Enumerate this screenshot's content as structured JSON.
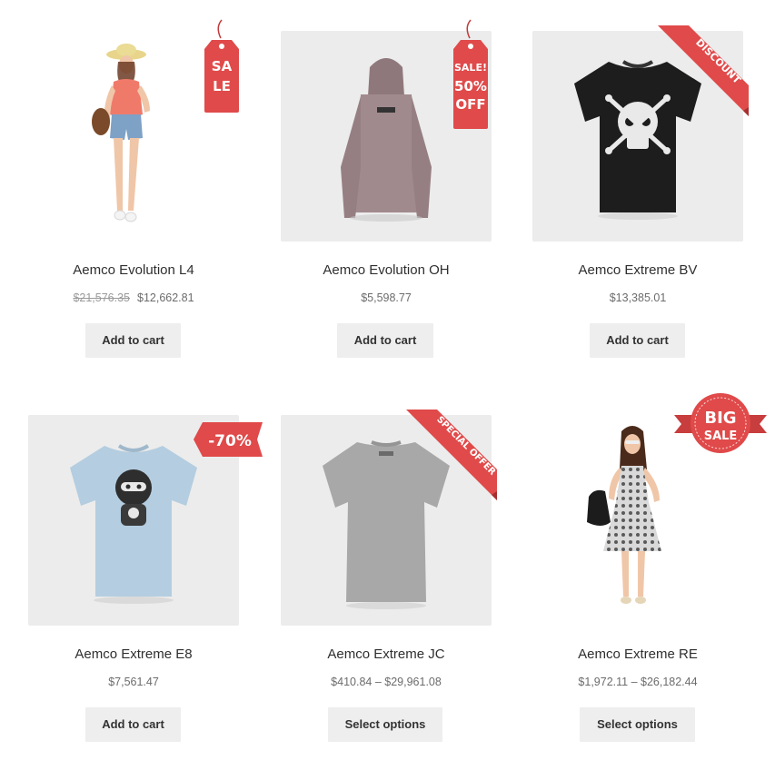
{
  "products": [
    {
      "name": "Aemco Evolution L4",
      "price_old": "$21,576.35",
      "price": "$12,662.81",
      "button": "Add to cart",
      "badge": {
        "lines": [
          "SA",
          "LE"
        ],
        "style": "hang-tag"
      }
    },
    {
      "name": "Aemco Evolution OH",
      "price": "$5,598.77",
      "button": "Add to cart",
      "badge": {
        "lines": [
          "SALE!",
          "50%",
          "OFF"
        ],
        "style": "hang-tag"
      }
    },
    {
      "name": "Aemco Extreme BV",
      "price": "$13,385.01",
      "button": "Add to cart",
      "badge": {
        "lines": [
          "DISCOUNT"
        ],
        "style": "corner-ribbon"
      }
    },
    {
      "name": "Aemco Extreme E8",
      "price": "$7,561.47",
      "button": "Add to cart",
      "badge": {
        "lines": [
          "-70%"
        ],
        "style": "ribbon-tag"
      }
    },
    {
      "name": "Aemco Extreme JC",
      "price": "$410.84 – $29,961.08",
      "button": "Select options",
      "badge": {
        "lines": [
          "SPECIAL OFFER"
        ],
        "style": "corner-ribbon"
      }
    },
    {
      "name": "Aemco Extreme RE",
      "price": "$1,972.11 – $26,182.44",
      "button": "Select options",
      "badge": {
        "lines": [
          "BIG",
          "SALE"
        ],
        "style": "circle-ribbon"
      }
    }
  ],
  "colors": {
    "badge_red": "#e04a4a",
    "button_bg": "#eeeeee",
    "thumb_bg": "#ececec"
  },
  "icons": [
    "hang-tag-badge",
    "corner-ribbon-badge",
    "circle-badge"
  ]
}
